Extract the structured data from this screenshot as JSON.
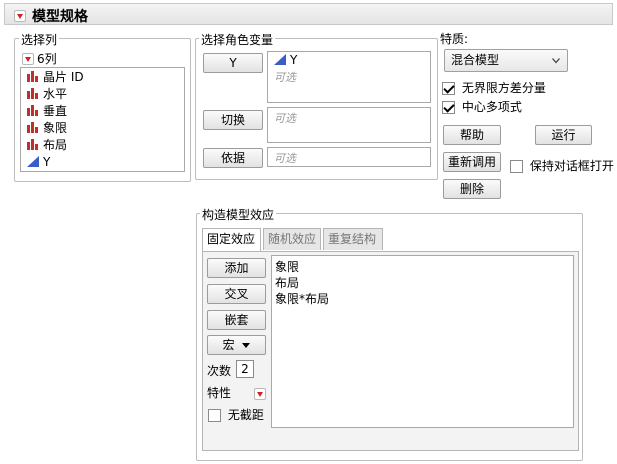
{
  "title": "模型规格",
  "select_columns": {
    "label": "选择列",
    "count_label": "6列",
    "columns": [
      {
        "name": "晶片 ID",
        "icon": "bar-icon"
      },
      {
        "name": "水平",
        "icon": "bar-icon"
      },
      {
        "name": "垂直",
        "icon": "bar-icon"
      },
      {
        "name": "象限",
        "icon": "bar-icon"
      },
      {
        "name": "布局",
        "icon": "bar-icon"
      },
      {
        "name": "Y",
        "icon": "triangle-icon"
      }
    ]
  },
  "roles": {
    "label": "选择角色变量",
    "y": {
      "button": "Y",
      "value": "Y",
      "placeholder": "可选"
    },
    "switch": {
      "button": "切换",
      "placeholder": "可选"
    },
    "by": {
      "button": "依据",
      "placeholder": "可选"
    }
  },
  "personality": {
    "label": "特质:",
    "selected": "混合模型",
    "option_unbounded": "无界限方差分量",
    "option_center": "中心多项式"
  },
  "actions": {
    "help": "帮助",
    "run": "运行",
    "recall": "重新调用",
    "keep_open": "保持对话框打开",
    "remove": "删除"
  },
  "construct": {
    "label": "构造模型效应",
    "tabs": [
      "固定效应",
      "随机效应",
      "重复结构"
    ],
    "buttons": {
      "add": "添加",
      "cross": "交叉",
      "nest": "嵌套",
      "macro": "宏"
    },
    "degree_label": "次数",
    "degree_value": "2",
    "attributes_label": "特性",
    "no_intercept": "无截距",
    "effects": [
      "象限",
      "布局",
      "象限*布局"
    ]
  },
  "colors": {
    "accent_red": "#d42020",
    "bar_red": "#c0302a",
    "triangle_blue": "#3a5ec8"
  }
}
